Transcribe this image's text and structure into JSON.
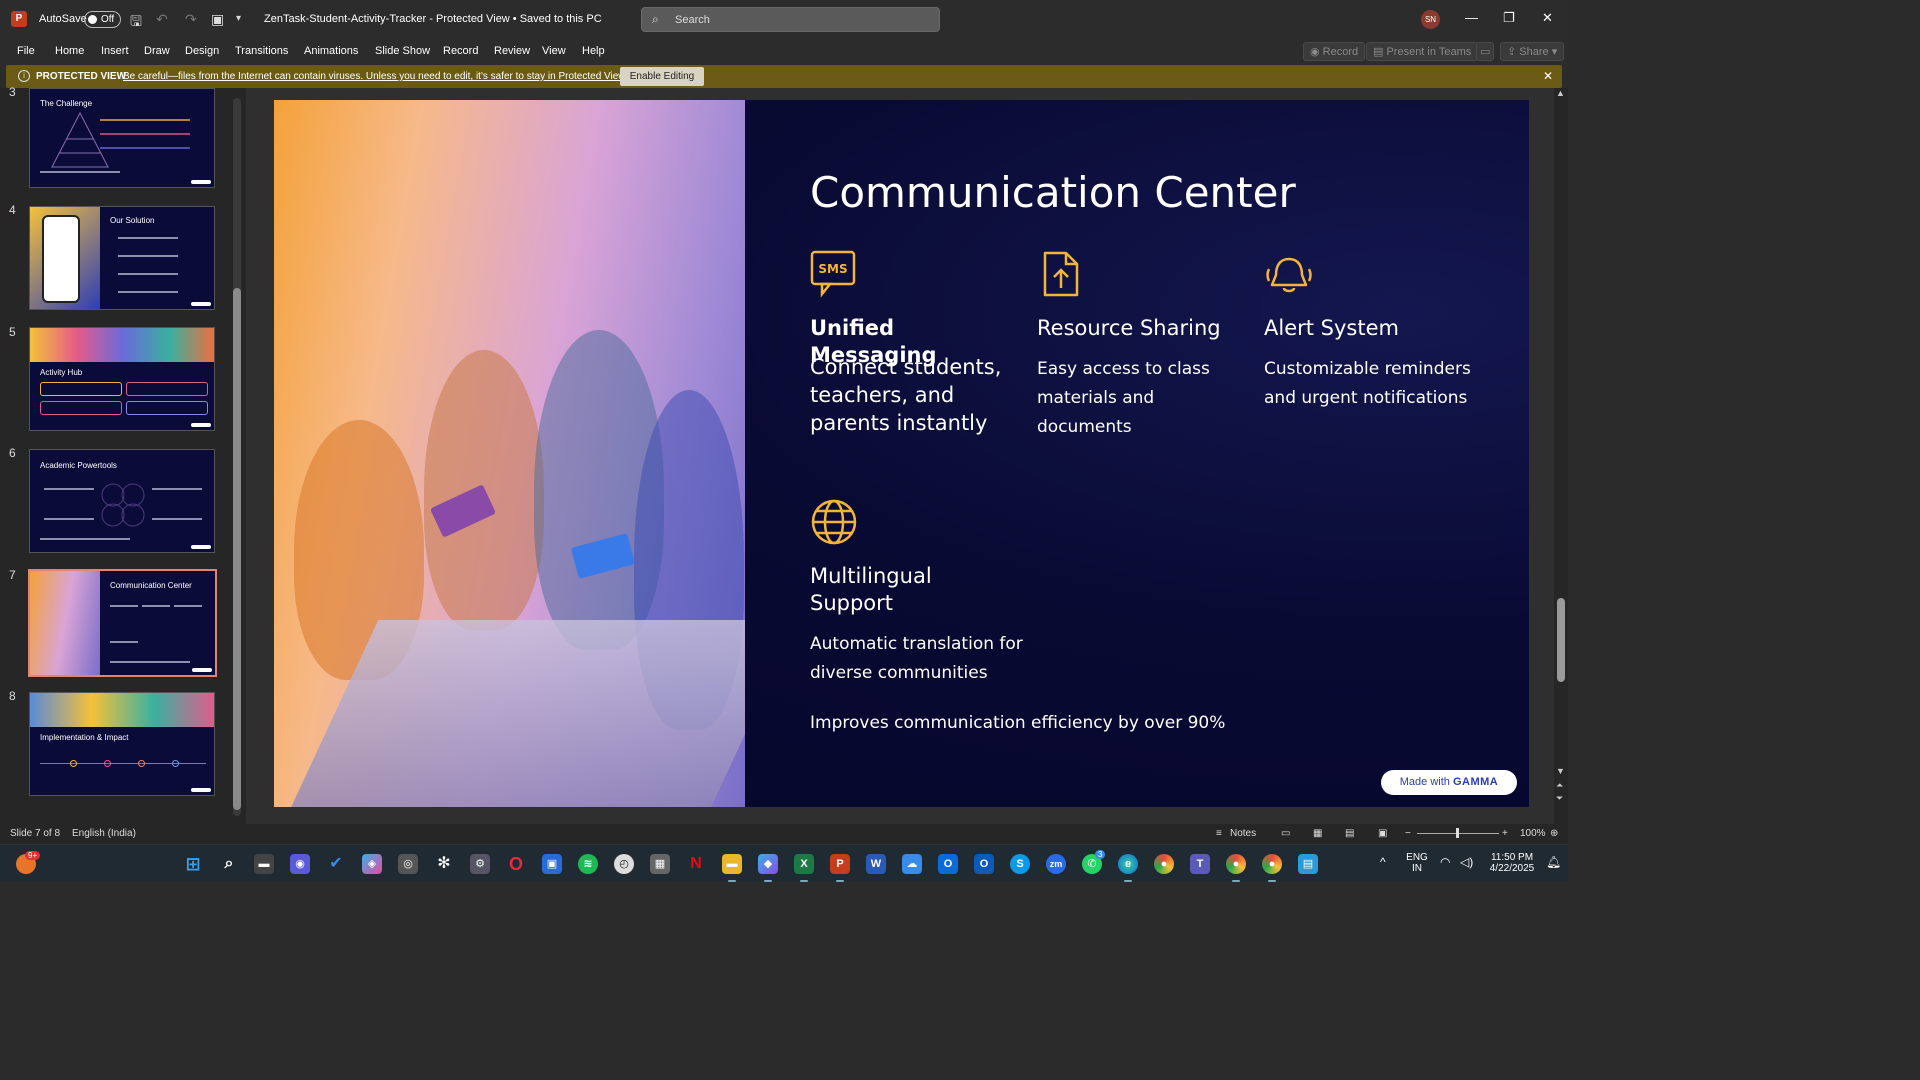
{
  "titlebar": {
    "autosave_label": "AutoSave",
    "autosave_state": "Off",
    "doc_title": "ZenTask-Student-Activity-Tracker  -  Protected View  •  Saved to this PC",
    "search_placeholder": "Search",
    "user_initials": "SN"
  },
  "menu": {
    "items": [
      "File",
      "Home",
      "Insert",
      "Draw",
      "Design",
      "Transitions",
      "Animations",
      "Slide Show",
      "Record",
      "Review",
      "View",
      "Help"
    ],
    "record_button": "Record",
    "present_button": "Present in Teams",
    "share_button": "Share"
  },
  "protected_view": {
    "title": "PROTECTED VIEW",
    "message": "Be careful—files from the Internet can contain viruses. Unless you need to edit, it's safer to stay in Protected View.",
    "enable_button": "Enable Editing"
  },
  "thumbnails": [
    {
      "number": "3",
      "title": "The Challenge"
    },
    {
      "number": "4",
      "title": "Our Solution"
    },
    {
      "number": "5",
      "title": "Activity Hub"
    },
    {
      "number": "6",
      "title": "Academic Powertools"
    },
    {
      "number": "7",
      "title": "Communication Center"
    },
    {
      "number": "8",
      "title": "Implementation & Impact"
    }
  ],
  "slide": {
    "title": "Communication Center",
    "features": [
      {
        "icon": "sms-icon",
        "heading": "Unified Messaging",
        "body": "Connect students, teachers, and parents instantly"
      },
      {
        "icon": "file-upload-icon",
        "heading": "Resource Sharing",
        "body": "Easy access to class materials and documents"
      },
      {
        "icon": "bell-icon",
        "heading": "Alert System",
        "body": "Customizable reminders and urgent notifications"
      },
      {
        "icon": "globe-icon",
        "heading": "Multilingual Support",
        "body": "Automatic translation for diverse communities"
      }
    ],
    "footer": "Improves communication efficiency by over 90%",
    "badge_prefix": "Made with",
    "badge_brand": "GAMMA"
  },
  "statusbar": {
    "slide_info": "Slide 7 of 8",
    "language": "English (India)",
    "notes": "Notes",
    "zoom": "100%"
  },
  "taskbar": {
    "notification_count": "9+",
    "lang_top": "ENG",
    "lang_bottom": "IN",
    "time": "11:50 PM",
    "date": "4/22/2025",
    "teams_badge": "3"
  },
  "colors": {
    "accent": "#f4b43a",
    "slide_bg": "#090a33",
    "protected_bg": "#6b5a14",
    "selected_thumb": "#e5846e"
  }
}
